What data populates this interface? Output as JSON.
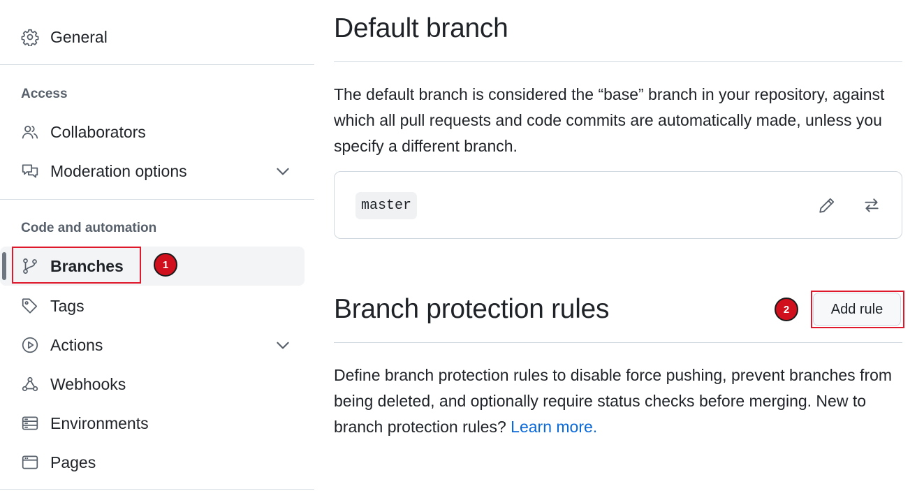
{
  "sidebar": {
    "general": {
      "label": "General",
      "icon": "gear-icon"
    },
    "access": {
      "heading": "Access",
      "items": [
        {
          "label": "Collaborators",
          "icon": "people-icon"
        },
        {
          "label": "Moderation options",
          "icon": "report-icon",
          "expandable": true
        }
      ]
    },
    "code_automation": {
      "heading": "Code and automation",
      "items": [
        {
          "label": "Branches",
          "icon": "git-branch-icon",
          "active": true
        },
        {
          "label": "Tags",
          "icon": "tag-icon"
        },
        {
          "label": "Actions",
          "icon": "play-icon",
          "expandable": true
        },
        {
          "label": "Webhooks",
          "icon": "webhook-icon"
        },
        {
          "label": "Environments",
          "icon": "server-icon"
        },
        {
          "label": "Pages",
          "icon": "browser-icon"
        }
      ]
    }
  },
  "main": {
    "default_branch": {
      "title": "Default branch",
      "description": "The default branch is considered the “base” branch in your repository, against which all pull requests and code commits are automatically made, unless you specify a different branch.",
      "branch_name": "master",
      "edit_icon": "pencil-icon",
      "switch_icon": "arrow-switch-icon"
    },
    "protection": {
      "title": "Branch protection rules",
      "add_rule_label": "Add rule",
      "description": "Define branch protection rules to disable force pushing, prevent branches from being deleted, and optionally require status checks before merging. New to branch protection rules?",
      "learn_more": "Learn more."
    }
  },
  "annotations": {
    "step1": "1",
    "step2": "2"
  },
  "colors": {
    "highlight": "#e0182b",
    "marker": "#d0111d",
    "link": "#0969da"
  }
}
